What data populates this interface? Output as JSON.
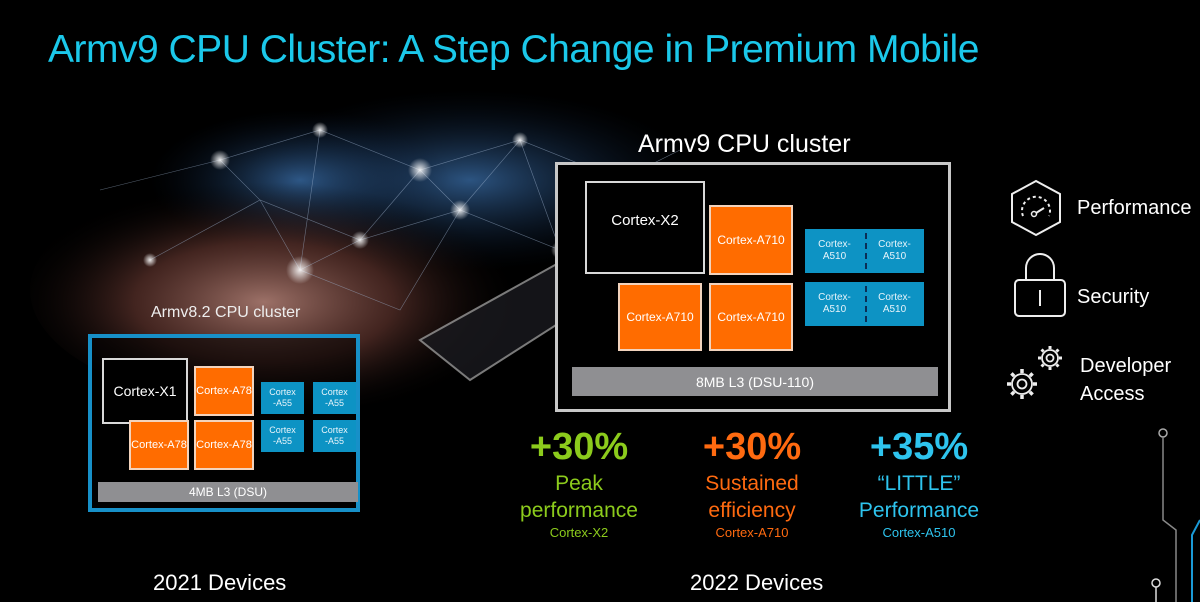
{
  "title": "Armv9 CPU Cluster: A Step Change in Premium Mobile",
  "colors": {
    "title": "#1bc8ea",
    "big_core": "#000000",
    "mid_core": "#ff6c00",
    "little_core": "#0d93c4",
    "l3": "#8f8f92",
    "armv82_border": "#1790c8",
    "armv9_border": "#c8c8c8",
    "green": "#8ccb1c",
    "orange": "#ff6a10",
    "blue": "#2ec4ee"
  },
  "armv82_cluster": {
    "label": "Armv8.2 CPU cluster",
    "big_core": "Cortex-X1",
    "mid_cores": [
      "Cortex-A78",
      "Cortex-A78",
      "Cortex-A78"
    ],
    "little_cores": [
      "Cortex\n-A55",
      "Cortex\n-A55",
      "Cortex\n-A55",
      "Cortex\n-A55"
    ],
    "l3": "4MB L3 (DSU)",
    "year": "2021 Devices"
  },
  "armv9_cluster": {
    "label": "Armv9 CPU cluster",
    "big_core": "Cortex-X2",
    "mid_cores": [
      "Cortex-A710",
      "Cortex-A710",
      "Cortex-A710"
    ],
    "little_pairs": [
      [
        "Cortex-\nA510",
        "Cortex-\nA510"
      ],
      [
        "Cortex-\nA510",
        "Cortex-\nA510"
      ]
    ],
    "l3": "8MB L3 (DSU-110)",
    "year": "2022 Devices"
  },
  "stats": [
    {
      "value": "+30%",
      "line1": "Peak",
      "line2": "performance",
      "core": "Cortex-X2",
      "color": "green"
    },
    {
      "value": "+30%",
      "line1": "Sustained",
      "line2": "efficiency",
      "core": "Cortex-A710",
      "color": "orange"
    },
    {
      "value": "+35%",
      "line1": "“LITTLE”",
      "line2": "Performance",
      "core": "Cortex-A510",
      "color": "blue"
    }
  ],
  "features": [
    {
      "icon": "speedometer-icon",
      "label": "Performance"
    },
    {
      "icon": "padlock-icon",
      "label": "Security"
    },
    {
      "icon": "gears-icon",
      "label": "Developer\nAccess"
    }
  ]
}
